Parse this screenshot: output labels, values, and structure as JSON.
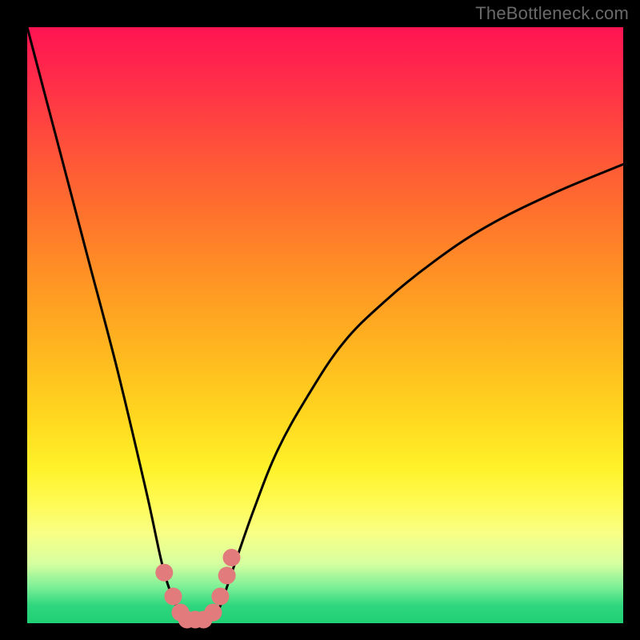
{
  "watermark": "TheBottleneck.com",
  "chart_data": {
    "type": "line",
    "title": "",
    "xlabel": "",
    "ylabel": "",
    "xlim": [
      0,
      1
    ],
    "ylim": [
      0,
      1
    ],
    "series": [
      {
        "name": "bottleneck-curve",
        "x": [
          0.0,
          0.05,
          0.1,
          0.15,
          0.2,
          0.23,
          0.255,
          0.27,
          0.285,
          0.3,
          0.32,
          0.345,
          0.38,
          0.42,
          0.47,
          0.53,
          0.6,
          0.68,
          0.77,
          0.88,
          1.0
        ],
        "values": [
          1.0,
          0.81,
          0.62,
          0.43,
          0.22,
          0.085,
          0.02,
          0.0,
          0.0,
          0.0,
          0.02,
          0.09,
          0.19,
          0.29,
          0.38,
          0.47,
          0.54,
          0.605,
          0.665,
          0.72,
          0.77
        ]
      }
    ],
    "markers": {
      "name": "highlight-dots",
      "color": "#e27c7c",
      "points_xy": [
        [
          0.23,
          0.085
        ],
        [
          0.245,
          0.045
        ],
        [
          0.257,
          0.018
        ],
        [
          0.268,
          0.006
        ],
        [
          0.282,
          0.006
        ],
        [
          0.296,
          0.006
        ],
        [
          0.312,
          0.018
        ],
        [
          0.324,
          0.045
        ],
        [
          0.335,
          0.08
        ],
        [
          0.343,
          0.11
        ]
      ]
    },
    "gradient_stops": [
      {
        "pos": 0.0,
        "color": "#ff1452"
      },
      {
        "pos": 0.5,
        "color": "#ffb81f"
      },
      {
        "pos": 0.8,
        "color": "#fffb55"
      },
      {
        "pos": 1.0,
        "color": "#1fcf74"
      }
    ]
  }
}
